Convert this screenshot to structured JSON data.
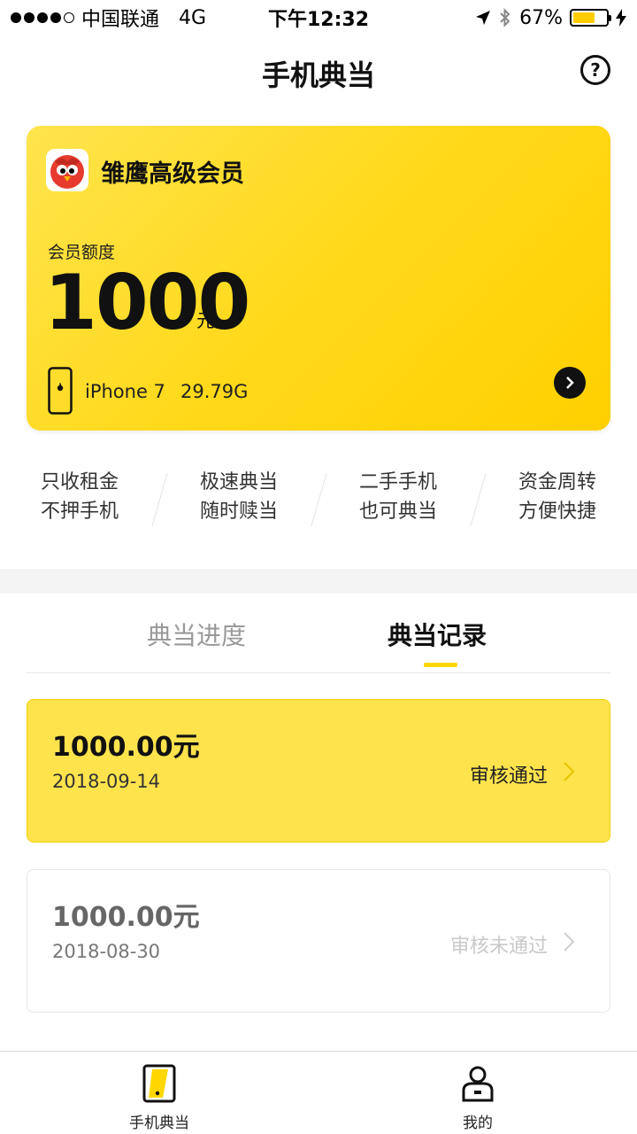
{
  "status_bar": {
    "carrier": "中国联通",
    "network": "4G",
    "time": "下午12:32",
    "battery": "67%",
    "battery_level": 0.67
  },
  "header": {
    "title": "手机典当",
    "help_label": "?"
  },
  "member_card": {
    "title": "雏鹰高级会员",
    "quota_label": "会员额度",
    "quota_amount": "1000",
    "quota_unit": "元",
    "phone_model": "iPhone 7",
    "phone_storage": "29.79G",
    "colors": {
      "accent": "#FFD700",
      "card_start": "#FFE44D",
      "card_end": "#FFD000"
    }
  },
  "features": [
    {
      "line1": "只收租金",
      "line2": "不押手机"
    },
    {
      "line1": "极速典当",
      "line2": "随时赎当"
    },
    {
      "line1": "二手手机",
      "line2": "也可典当"
    },
    {
      "line1": "资金周转",
      "line2": "方便快捷"
    }
  ],
  "tabs": {
    "progress": "典当进度",
    "records": "典当记录",
    "active": "records"
  },
  "records": [
    {
      "amount": "1000.00元",
      "date": "2018-09-14",
      "status": "审核通过"
    },
    {
      "amount": "1000.00元",
      "date": "2018-08-30",
      "status": "审核未通过"
    }
  ],
  "tabbar": {
    "items": [
      {
        "label": "手机典当",
        "icon": "phone-pawn-icon"
      },
      {
        "label": "我的",
        "icon": "user-icon"
      }
    ]
  }
}
